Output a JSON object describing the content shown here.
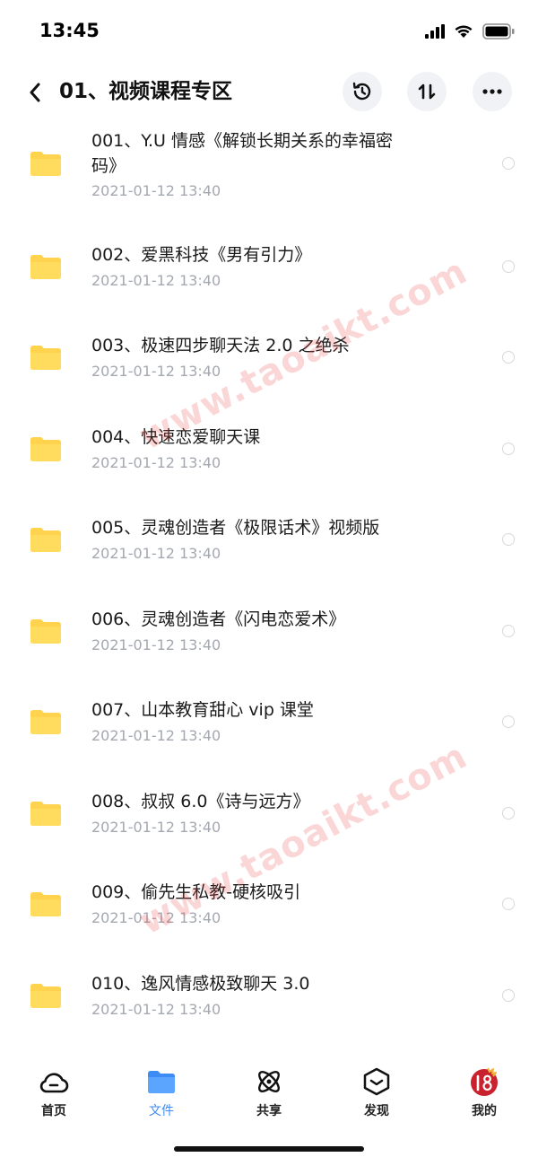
{
  "status": {
    "time": "13:45"
  },
  "header": {
    "title": "01、视频课程专区"
  },
  "items": [
    {
      "name": "001、Y.U 情感《解锁长期关系的幸福密码》",
      "date": "2021-01-12 13:40"
    },
    {
      "name": "002、爱黑科技《男有引力》",
      "date": "2021-01-12 13:40"
    },
    {
      "name": "003、极速四步聊天法 2.0 之绝杀",
      "date": "2021-01-12 13:40"
    },
    {
      "name": "004、快速恋爱聊天课",
      "date": "2021-01-12 13:40"
    },
    {
      "name": "005、灵魂创造者《极限话术》视频版",
      "date": "2021-01-12 13:40"
    },
    {
      "name": "006、灵魂创造者《闪电恋爱术》",
      "date": "2021-01-12 13:40"
    },
    {
      "name": "007、山本教育甜心 vip 课堂",
      "date": "2021-01-12 13:40"
    },
    {
      "name": "008、叔叔 6.0《诗与远方》",
      "date": "2021-01-12 13:40"
    },
    {
      "name": "009、偷先生私教-硬核吸引",
      "date": "2021-01-12 13:40"
    },
    {
      "name": "010、逸风情感极致聊天 3.0",
      "date": "2021-01-12 13:40"
    }
  ],
  "watermark": "www.taoaikt.com",
  "tabs": [
    {
      "label": "首页",
      "icon": "cloud-icon",
      "active": false
    },
    {
      "label": "文件",
      "icon": "folder-icon",
      "active": true
    },
    {
      "label": "共享",
      "icon": "atom-icon",
      "active": false
    },
    {
      "label": "发现",
      "icon": "cube-icon",
      "active": false
    },
    {
      "label": "我的",
      "icon": "avatar-icon",
      "active": false
    }
  ],
  "colors": {
    "accent": "#3d8bf5",
    "folder": "#ffd34d",
    "date": "#a4a8b0"
  }
}
